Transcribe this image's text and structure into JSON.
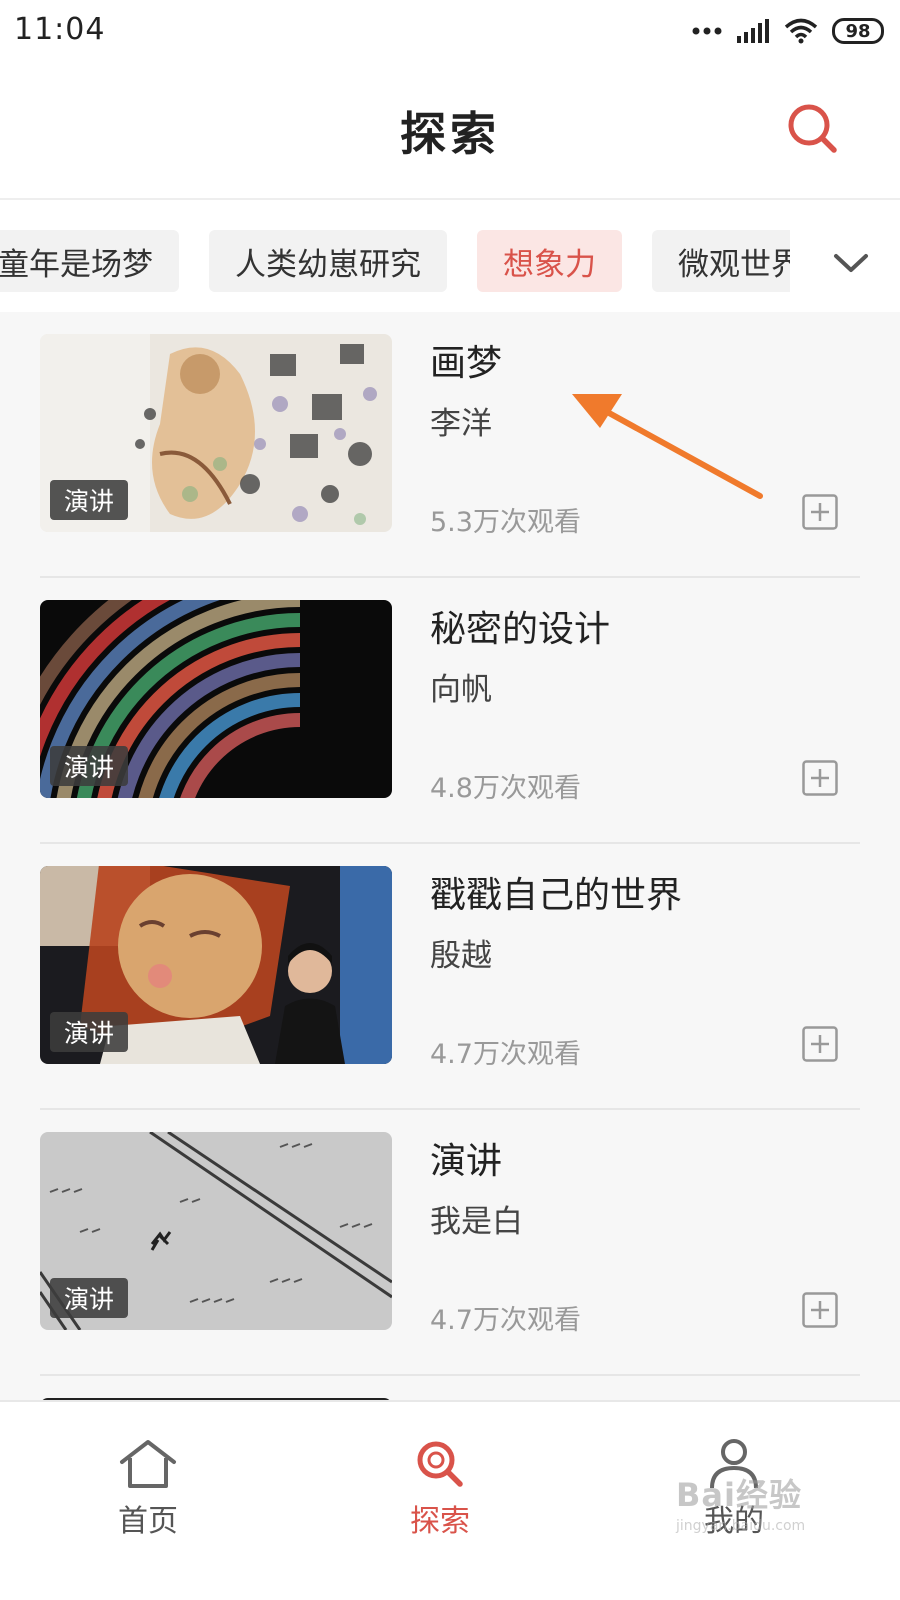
{
  "status_bar": {
    "time": "11:04",
    "battery": "98",
    "icons": [
      "more-dots-icon",
      "signal-icon",
      "wifi-icon",
      "battery-icon"
    ]
  },
  "header": {
    "title": "探索",
    "search_icon": "search-icon"
  },
  "category_tabs": [
    {
      "label": "童年是场梦",
      "active": false
    },
    {
      "label": "人类幼崽研究",
      "active": false
    },
    {
      "label": "想象力",
      "active": true
    },
    {
      "label": "微观世界",
      "active": false
    }
  ],
  "tabs_expand_icon": "chevron-down-icon",
  "videos": [
    {
      "badge": "演讲",
      "title": "画梦",
      "author": "李洋",
      "views": "5.3万次观看"
    },
    {
      "badge": "演讲",
      "title": "秘密的设计",
      "author": "向帆",
      "views": "4.8万次观看"
    },
    {
      "badge": "演讲",
      "title": "戳戳自己的世界",
      "author": "殷越",
      "views": "4.7万次观看"
    },
    {
      "badge": "演讲",
      "title": "演讲",
      "author": "我是白",
      "views": "4.7万次观看"
    }
  ],
  "bottom_nav": [
    {
      "label": "首页",
      "icon": "home-icon",
      "active": false
    },
    {
      "label": "探索",
      "icon": "search-icon",
      "active": true
    },
    {
      "label": "我的",
      "icon": "user-icon",
      "active": false
    }
  ],
  "watermark": {
    "main": "Bai经验",
    "sub": "jingyan.baidu.com"
  },
  "colors": {
    "accent": "#d9534a",
    "annotation_arrow": "#f07a2c"
  }
}
